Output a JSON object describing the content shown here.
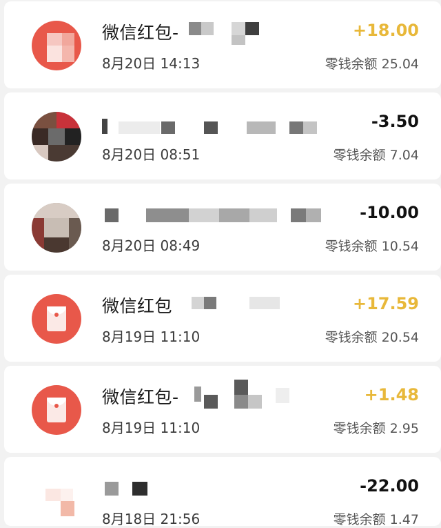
{
  "transactions": [
    {
      "title": "微信红包-",
      "time": "8月20日 14:13",
      "amount": "+18.00",
      "balance": "零钱余额 25.04",
      "icon": "red-packet-icon",
      "direction": "in"
    },
    {
      "title": "",
      "time": "8月20日 08:51",
      "amount": "-3.50",
      "balance": "零钱余额 7.04",
      "icon": "user-avatar",
      "direction": "out"
    },
    {
      "title": "",
      "time": "8月20日 08:49",
      "amount": "-10.00",
      "balance": "零钱余额 10.54",
      "icon": "user-avatar",
      "direction": "out"
    },
    {
      "title": "微信红包",
      "time": "8月19日 11:10",
      "amount": "+17.59",
      "balance": "零钱余额 20.54",
      "icon": "red-packet-icon",
      "direction": "in"
    },
    {
      "title": "微信红包-",
      "time": "8月19日 11:10",
      "amount": "+1.48",
      "balance": "零钱余额 2.95",
      "icon": "red-packet-icon",
      "direction": "in"
    },
    {
      "title": "",
      "time": "8月18日 21:56",
      "amount": "-22.00",
      "balance": "零钱余额 1.47",
      "icon": "user-avatar",
      "direction": "out"
    }
  ],
  "colors": {
    "income": "#e8b83a",
    "expense": "#111111",
    "red_packet": "#e8584a"
  }
}
